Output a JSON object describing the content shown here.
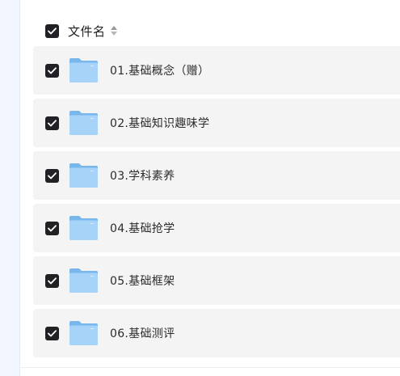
{
  "header": {
    "column_label": "文件名",
    "select_all_checked": true
  },
  "files": [
    {
      "name": "01.基础概念（赠）",
      "type": "folder",
      "checked": true
    },
    {
      "name": "02.基础知识趣味学",
      "type": "folder",
      "checked": true
    },
    {
      "name": "03.学科素养",
      "type": "folder",
      "checked": true
    },
    {
      "name": "04.基础抢学",
      "type": "folder",
      "checked": true
    },
    {
      "name": "05.基础框架",
      "type": "folder",
      "checked": true
    },
    {
      "name": "06.基础测评",
      "type": "folder",
      "checked": true
    }
  ],
  "icons": {
    "checkbox": "checkbox-checked-icon",
    "sort": "sort-icon",
    "folder": "folder-icon"
  },
  "colors": {
    "checkbox_fill": "#202124",
    "row_background": "#f4f4f4",
    "folder_blue": "#8cc4f4",
    "sidebar_background": "#f1f5fd"
  }
}
